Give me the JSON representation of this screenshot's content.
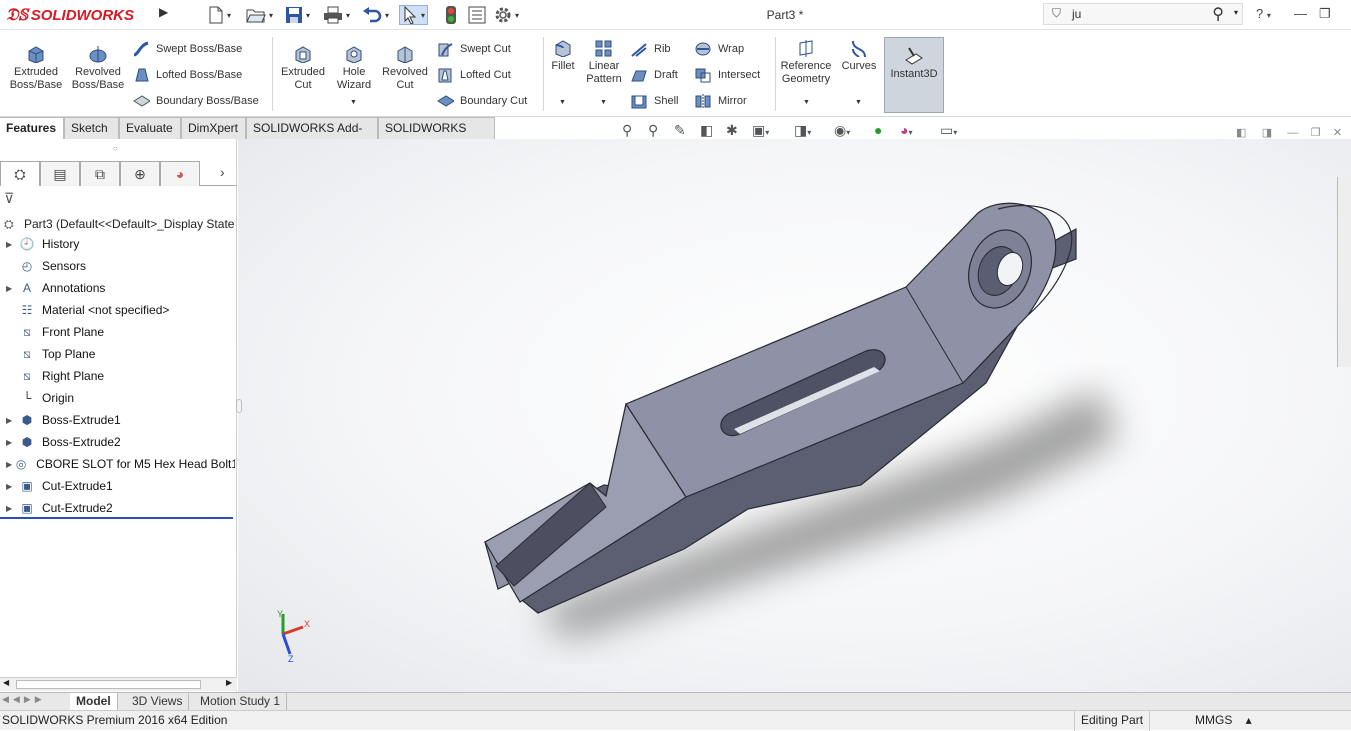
{
  "app": {
    "logo_text": "SOLIDWORKS",
    "document_title": "Part3 *",
    "search_value": "ju",
    "help_label": "?"
  },
  "quick_access": [
    {
      "icon": "new-document-icon"
    },
    {
      "icon": "open-folder-icon"
    },
    {
      "icon": "save-icon"
    },
    {
      "icon": "print-icon"
    },
    {
      "icon": "undo-icon"
    },
    {
      "icon": "select-arrow-icon"
    },
    {
      "icon": "rebuild-traffic-light-icon"
    },
    {
      "icon": "file-properties-icon"
    },
    {
      "icon": "options-gear-icon"
    }
  ],
  "ribbon": {
    "extruded_boss": "Extruded Boss/Base",
    "revolved_boss": "Revolved Boss/Base",
    "swept_boss": "Swept Boss/Base",
    "lofted_boss": "Lofted Boss/Base",
    "boundary_boss": "Boundary Boss/Base",
    "extruded_cut": "Extruded Cut",
    "hole_wizard": "Hole Wizard",
    "revolved_cut": "Revolved Cut",
    "swept_cut": "Swept Cut",
    "lofted_cut": "Lofted Cut",
    "boundary_cut": "Boundary Cut",
    "fillet": "Fillet",
    "linear_pattern": "Linear Pattern",
    "rib": "Rib",
    "draft": "Draft",
    "shell": "Shell",
    "wrap": "Wrap",
    "intersect": "Intersect",
    "mirror": "Mirror",
    "reference_geometry": "Reference Geometry",
    "curves": "Curves",
    "instant3d": "Instant3D"
  },
  "command_tabs": [
    "Features",
    "Sketch",
    "Evaluate",
    "DimXpert",
    "SOLIDWORKS Add-Ins",
    "SOLIDWORKS MBD"
  ],
  "feature_tree": {
    "root": "Part3  (Default<<Default>_Display State",
    "items": [
      {
        "label": "History",
        "expandable": true,
        "icon": "history-folder-icon"
      },
      {
        "label": "Sensors",
        "expandable": false,
        "icon": "sensors-icon"
      },
      {
        "label": "Annotations",
        "expandable": true,
        "icon": "annotations-icon"
      },
      {
        "label": "Material <not specified>",
        "expandable": false,
        "icon": "material-icon"
      },
      {
        "label": "Front Plane",
        "expandable": false,
        "icon": "plane-icon"
      },
      {
        "label": "Top Plane",
        "expandable": false,
        "icon": "plane-icon"
      },
      {
        "label": "Right Plane",
        "expandable": false,
        "icon": "plane-icon"
      },
      {
        "label": "Origin",
        "expandable": false,
        "icon": "origin-icon"
      },
      {
        "label": "Boss-Extrude1",
        "expandable": true,
        "icon": "boss-extrude-icon"
      },
      {
        "label": "Boss-Extrude2",
        "expandable": true,
        "icon": "boss-extrude-icon"
      },
      {
        "label": "CBORE SLOT for M5 Hex Head Bolt1",
        "expandable": true,
        "icon": "hole-wizard-icon"
      },
      {
        "label": "Cut-Extrude1",
        "expandable": true,
        "icon": "cut-extrude-icon"
      },
      {
        "label": "Cut-Extrude2",
        "expandable": true,
        "icon": "cut-extrude-icon"
      }
    ]
  },
  "triad": {
    "x": "X",
    "y": "Y",
    "z": "Z"
  },
  "bottom_tabs": [
    "Model",
    "3D Views",
    "Motion Study 1"
  ],
  "status": {
    "edition": "SOLIDWORKS Premium 2016 x64 Edition",
    "mode": "Editing Part",
    "units": "MMGS"
  },
  "colors": {
    "brand": "#d71921",
    "model_face_top": "#8f91a6",
    "model_face_side": "#6d6f85",
    "model_edge": "#2a2a33"
  }
}
